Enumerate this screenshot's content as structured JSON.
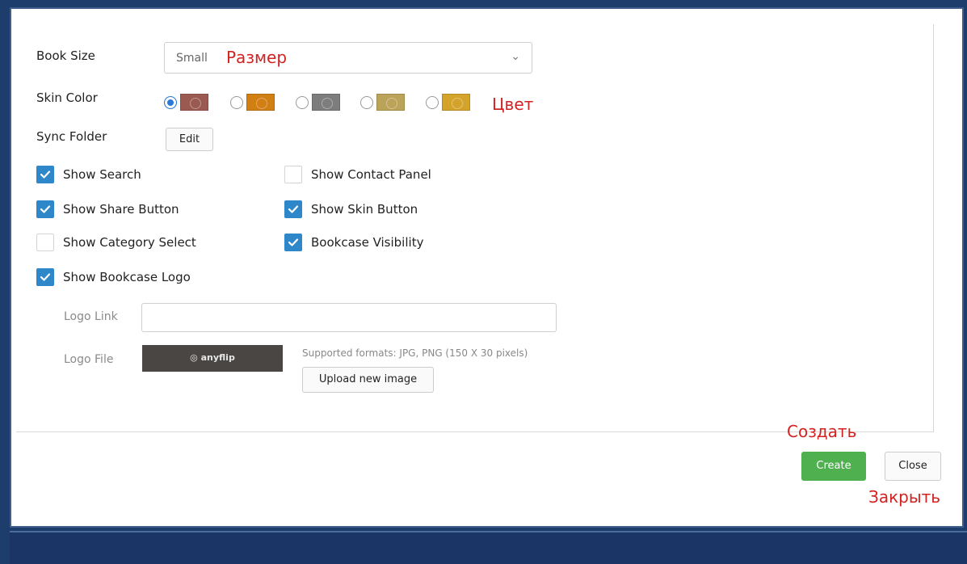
{
  "form": {
    "book_size_label": "Book Size",
    "book_size_value": "Small",
    "skin_color_label": "Skin Color",
    "sync_folder_label": "Sync Folder",
    "edit_button": "Edit",
    "skin_colors": [
      {
        "color": "#9a5a52",
        "selected": true
      },
      {
        "color": "#d17e12",
        "selected": false
      },
      {
        "color": "#7d7d7d",
        "selected": false
      },
      {
        "color": "#bca35a",
        "selected": false
      },
      {
        "color": "#d3a32a",
        "selected": false
      }
    ],
    "checkboxes": [
      {
        "label": "Show Search",
        "checked": true
      },
      {
        "label": "Show Contact Panel",
        "checked": false
      },
      {
        "label": "Show Share Button",
        "checked": true
      },
      {
        "label": "Show Skin Button",
        "checked": true
      },
      {
        "label": "Show Category Select",
        "checked": false
      },
      {
        "label": "Bookcase Visibility",
        "checked": true
      },
      {
        "label": "Show Bookcase Logo",
        "checked": true
      }
    ],
    "logo_link_label": "Logo Link",
    "logo_link_value": "",
    "logo_file_label": "Logo File",
    "logo_preview_text": "◎ anyflip",
    "supported_formats": "Supported formats: JPG, PNG (150 X 30 pixels)",
    "upload_button": "Upload new image"
  },
  "footer": {
    "create_button": "Create",
    "close_button": "Close"
  },
  "annotations": {
    "size": "Размер",
    "color": "Цвет",
    "create": "Создать",
    "close": "Закрыть"
  },
  "colors": {
    "accent": "#2d87c8",
    "create_green": "#4fb04f",
    "annotation_red": "#d22222",
    "frame_blue": "#1d3d6c"
  }
}
